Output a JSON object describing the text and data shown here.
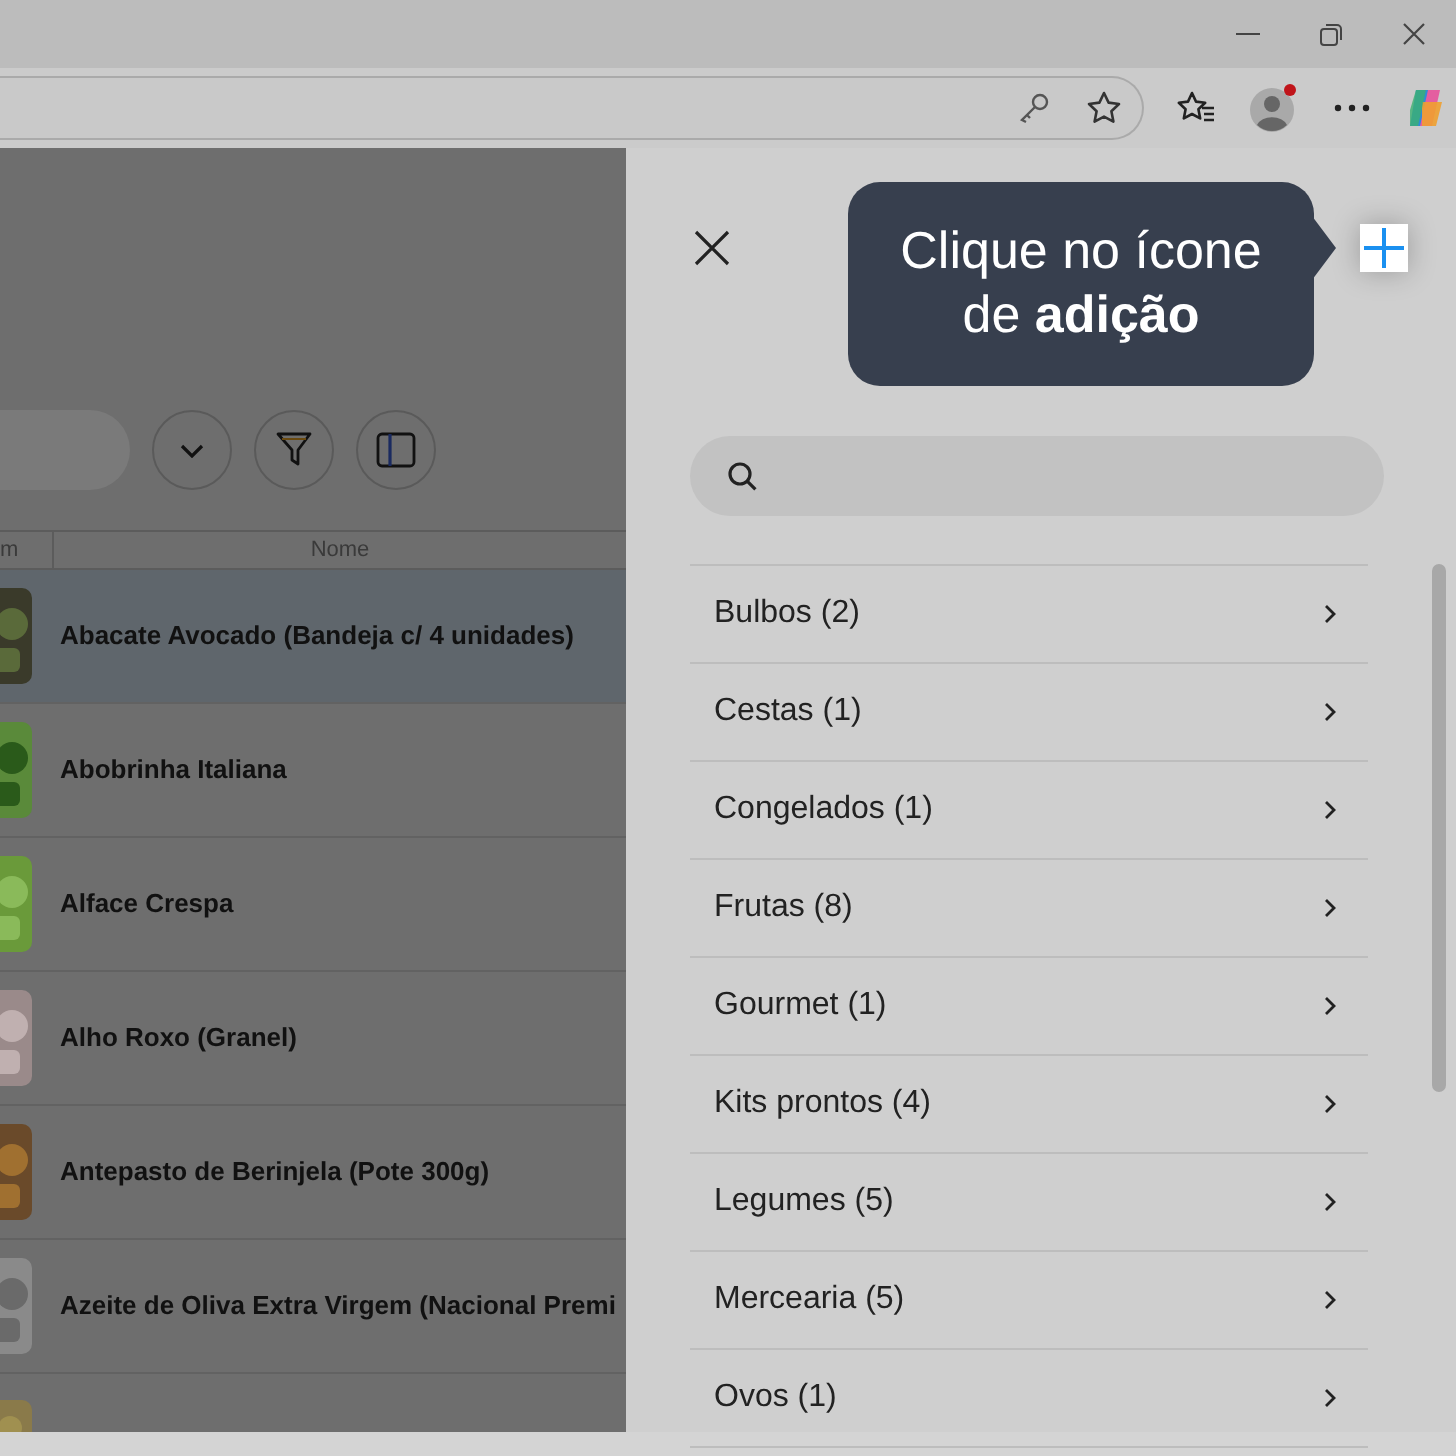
{
  "toolbar": {
    "column_1_header": "m",
    "name_header": "Nome"
  },
  "products": [
    {
      "name": "Abacate Avocado (Bandeja c/ 4 unidades)",
      "selected": true
    },
    {
      "name": "Abobrinha Italiana",
      "selected": false
    },
    {
      "name": "Alface Crespa",
      "selected": false
    },
    {
      "name": "Alho Roxo (Granel)",
      "selected": false
    },
    {
      "name": "Antepasto de Berinjela (Pote 300g)",
      "selected": false
    },
    {
      "name": "Azeite de Oliva Extra Virgem (Nacional Premi",
      "selected": false
    }
  ],
  "panel": {
    "tooltip": "Clique no ícone de **adição**",
    "categories": [
      "Bulbos (2)",
      "Cestas (1)",
      "Congelados (1)",
      "Frutas (8)",
      "Gourmet (1)",
      "Kits prontos (4)",
      "Legumes (5)",
      "Mercearia (5)",
      "Ovos (1)"
    ]
  }
}
